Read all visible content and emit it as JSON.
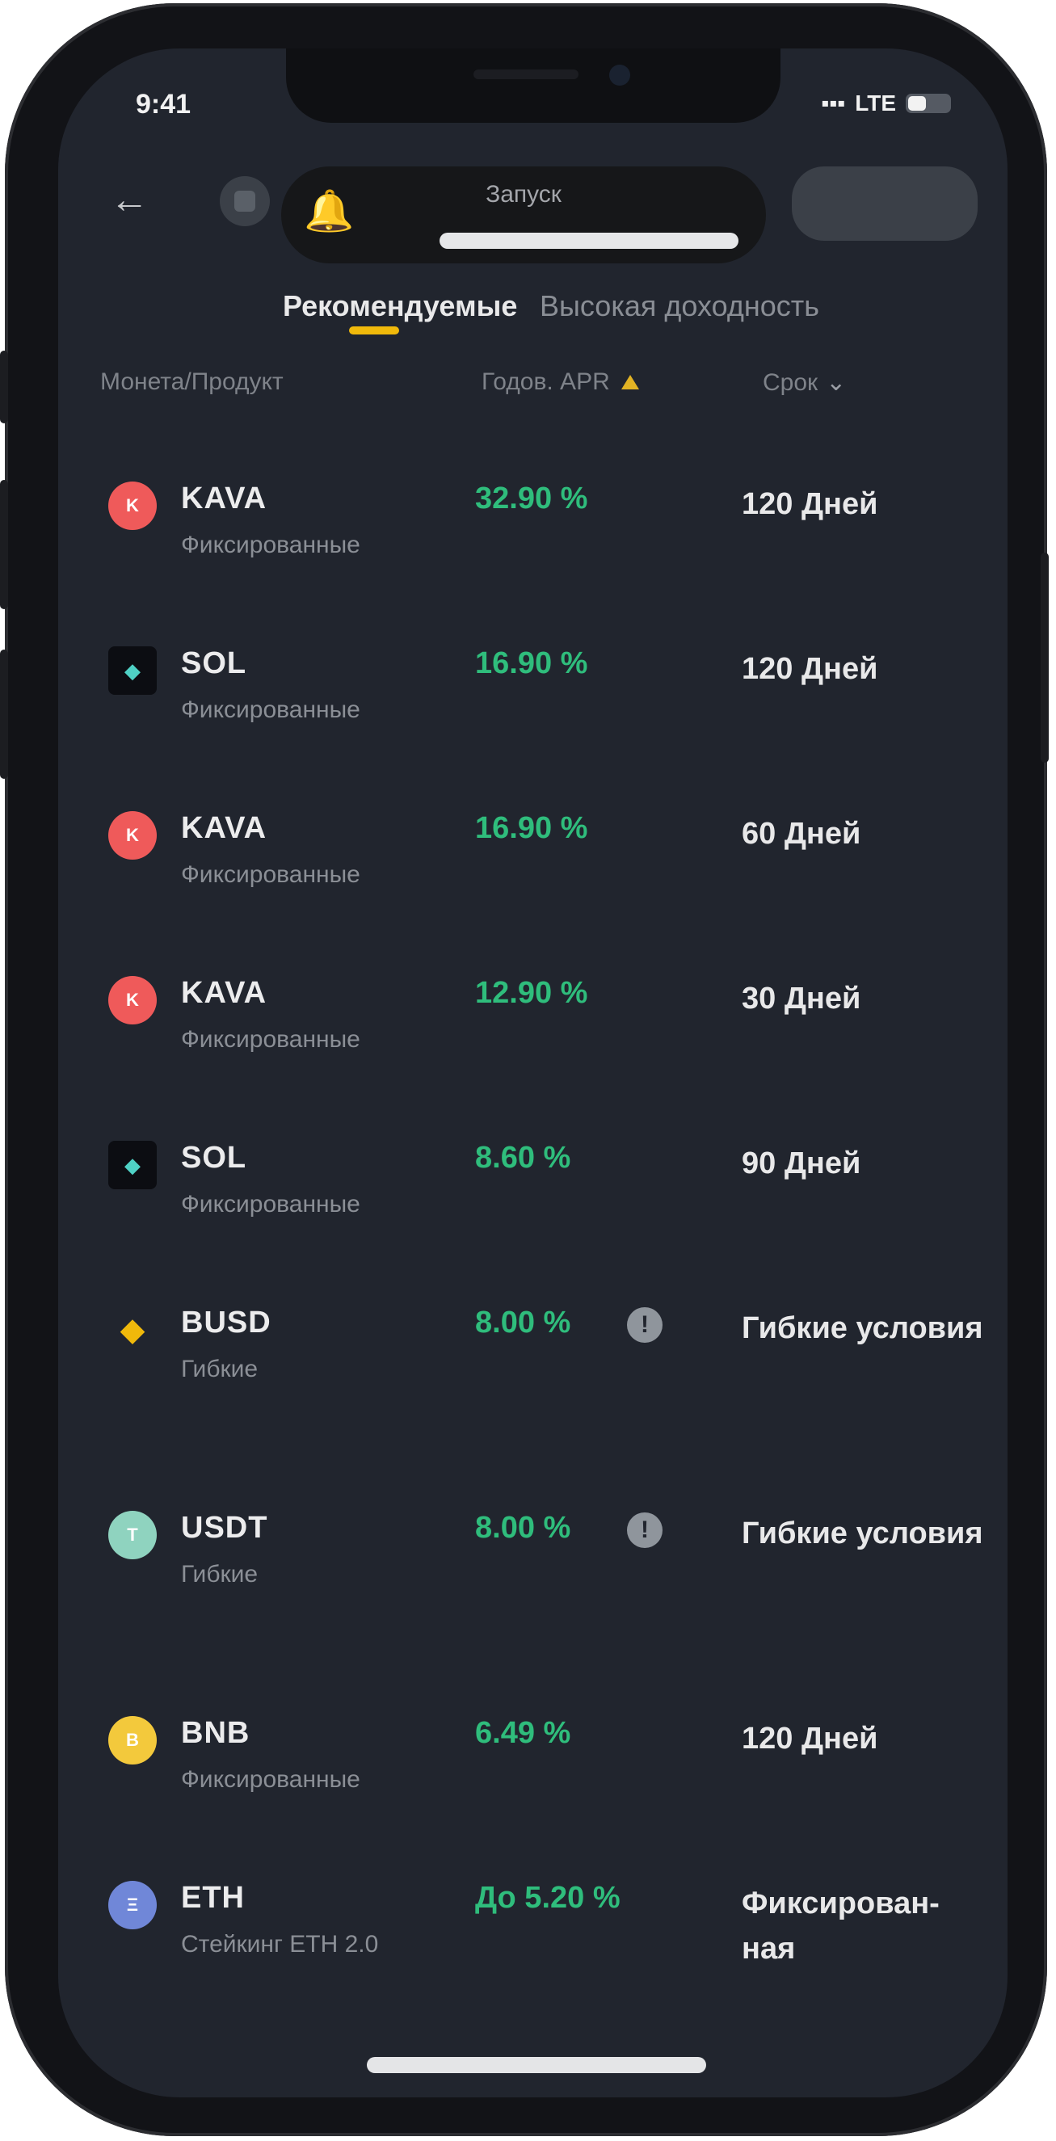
{
  "status_bar": {
    "time": "9:41",
    "network": "LTE"
  },
  "header": {
    "popup_title": "Запуск"
  },
  "tabs": {
    "active": "Рекомендуемые",
    "inactive": "Высокая доходность"
  },
  "columns": {
    "product": "Монета/Продукт",
    "apr": "Годов. APR",
    "term": "Срок"
  },
  "rows": [
    {
      "symbol": "KAVA",
      "type": "Фиксированные",
      "apr": "32.90 %",
      "term": "120 Дней",
      "coin": "K",
      "coin_class": "k"
    },
    {
      "symbol": "SOL",
      "type": "Фиксированные",
      "apr": "16.90 %",
      "term": "120 Дней",
      "coin": "◆",
      "coin_class": "s"
    },
    {
      "symbol": "KAVA",
      "type": "Фиксированные",
      "apr": "16.90 %",
      "term": "60 Дней",
      "coin": "K",
      "coin_class": "k"
    },
    {
      "symbol": "KAVA",
      "type": "Фиксированные",
      "apr": "12.90 %",
      "term": "30 Дней",
      "coin": "K",
      "coin_class": "k"
    },
    {
      "symbol": "SOL",
      "type": "Фиксированные",
      "apr": "8.60 %",
      "term": "90 Дней",
      "coin": "◆",
      "coin_class": "s"
    },
    {
      "symbol": "BUSD",
      "type": "Гибкие",
      "apr": "8.00 %",
      "term": "Гибкие условия",
      "coin": "◆",
      "coin_class": "b",
      "info": "!"
    },
    {
      "symbol": "USDT",
      "type": "Гибкие",
      "apr": "8.00 %",
      "term": "Гибкие условия",
      "coin": "T",
      "coin_class": "u",
      "info": "!"
    },
    {
      "symbol": "BNB",
      "type": "Фиксированные",
      "apr": "6.49 %",
      "term": "120 Дней",
      "coin": "B",
      "coin_class": "bn"
    },
    {
      "symbol": "ETH",
      "type": "Стейкинг ETH 2.0",
      "apr": "До 5.20 %",
      "term": "Фиксирован-ная",
      "coin": "Ξ",
      "coin_class": "e"
    }
  ]
}
